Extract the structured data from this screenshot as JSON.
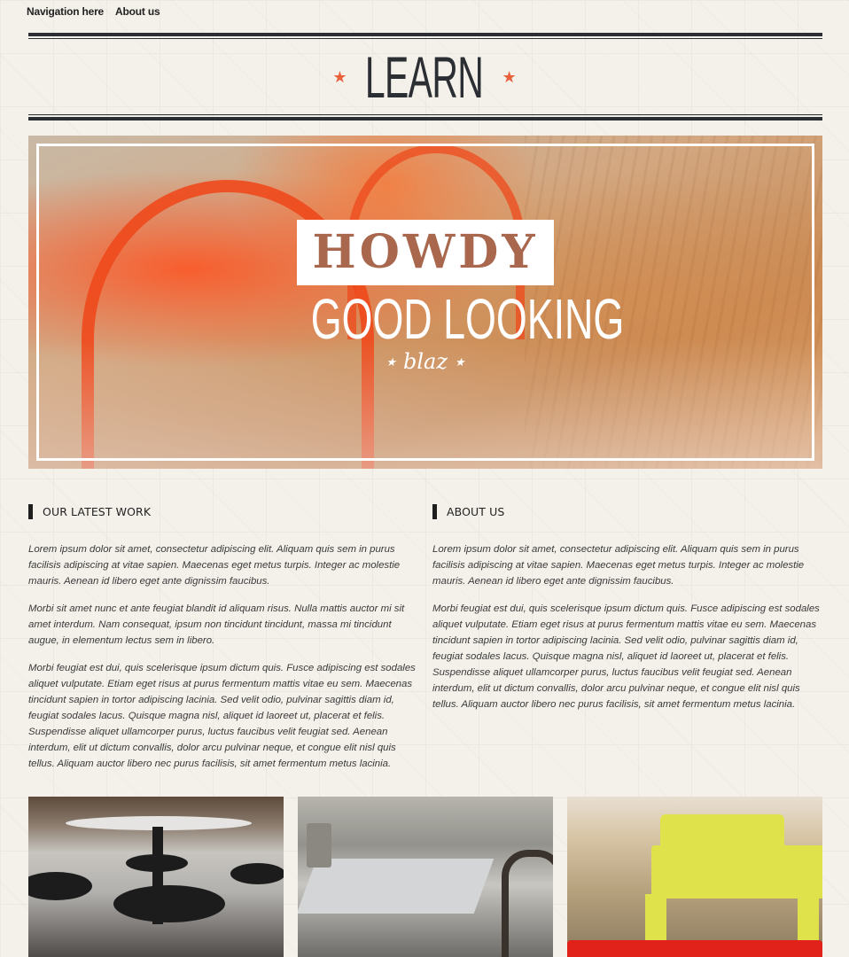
{
  "nav": {
    "items": [
      "Navigation here",
      "About us"
    ]
  },
  "logo": {
    "text": "LEARN",
    "star_color": "#e8603c"
  },
  "hero": {
    "line1": "HOWDY",
    "line2": "GOOD LOOKING",
    "line3": "blaz",
    "star": "★"
  },
  "sections": [
    {
      "title": "OUR LATEST WORK",
      "paragraphs": [
        "Lorem ipsum dolor sit amet, consectetur adipiscing elit. Aliquam quis sem in purus facilisis adipiscing at vitae sapien. Maecenas eget metus turpis. Integer ac molestie mauris. Aenean id libero eget ante dignissim faucibus.",
        "Morbi sit amet nunc et ante feugiat blandit id aliquam risus. Nulla mattis auctor mi sit amet interdum. Nam consequat, ipsum non tincidunt tincidunt, massa mi tincidunt augue, in elementum lectus sem in libero.",
        "Morbi feugiat est dui, quis scelerisque ipsum dictum quis. Fusce adipiscing est sodales aliquet vulputate. Etiam eget risus at purus fermentum mattis vitae eu sem. Maecenas tincidunt sapien in tortor adipiscing lacinia. Sed velit odio, pulvinar sagittis diam id, feugiat sodales lacus. Quisque magna nisl, aliquet id laoreet ut, placerat et felis. Suspendisse aliquet ullamcorper purus, luctus faucibus velit feugiat sed. Aenean interdum, elit ut dictum convallis, dolor arcu pulvinar neque, et congue elit nisl quis tellus. Aliquam auctor libero nec purus facilisis, sit amet fermentum metus lacinia."
      ]
    },
    {
      "title": "ABOUT US",
      "paragraphs": [
        "Lorem ipsum dolor sit amet, consectetur adipiscing elit. Aliquam quis sem in purus facilisis adipiscing at vitae sapien. Maecenas eget metus turpis. Integer ac molestie mauris. Aenean id libero eget ante dignissim faucibus.",
        "Morbi feugiat est dui, quis scelerisque ipsum dictum quis. Fusce adipiscing est sodales aliquet vulputate. Etiam eget risus at purus fermentum mattis vitae eu sem. Maecenas tincidunt sapien in tortor adipiscing lacinia. Sed velit odio, pulvinar sagittis diam id, feugiat sodales lacus. Quisque magna nisl, aliquet id laoreet ut, placerat et felis. Suspendisse aliquet ullamcorper purus, luctus faucibus velit feugiat sed. Aenean interdum, elit ut dictum convallis, dolor arcu pulvinar neque, et congue elit nisl quis tellus. Aliquam auctor libero nec purus facilisis, sit amet fermentum metus lacinia."
      ]
    }
  ],
  "colors": {
    "background": "#f4f1ea",
    "rule": "#2b2e33",
    "accent": "#e8603c"
  }
}
